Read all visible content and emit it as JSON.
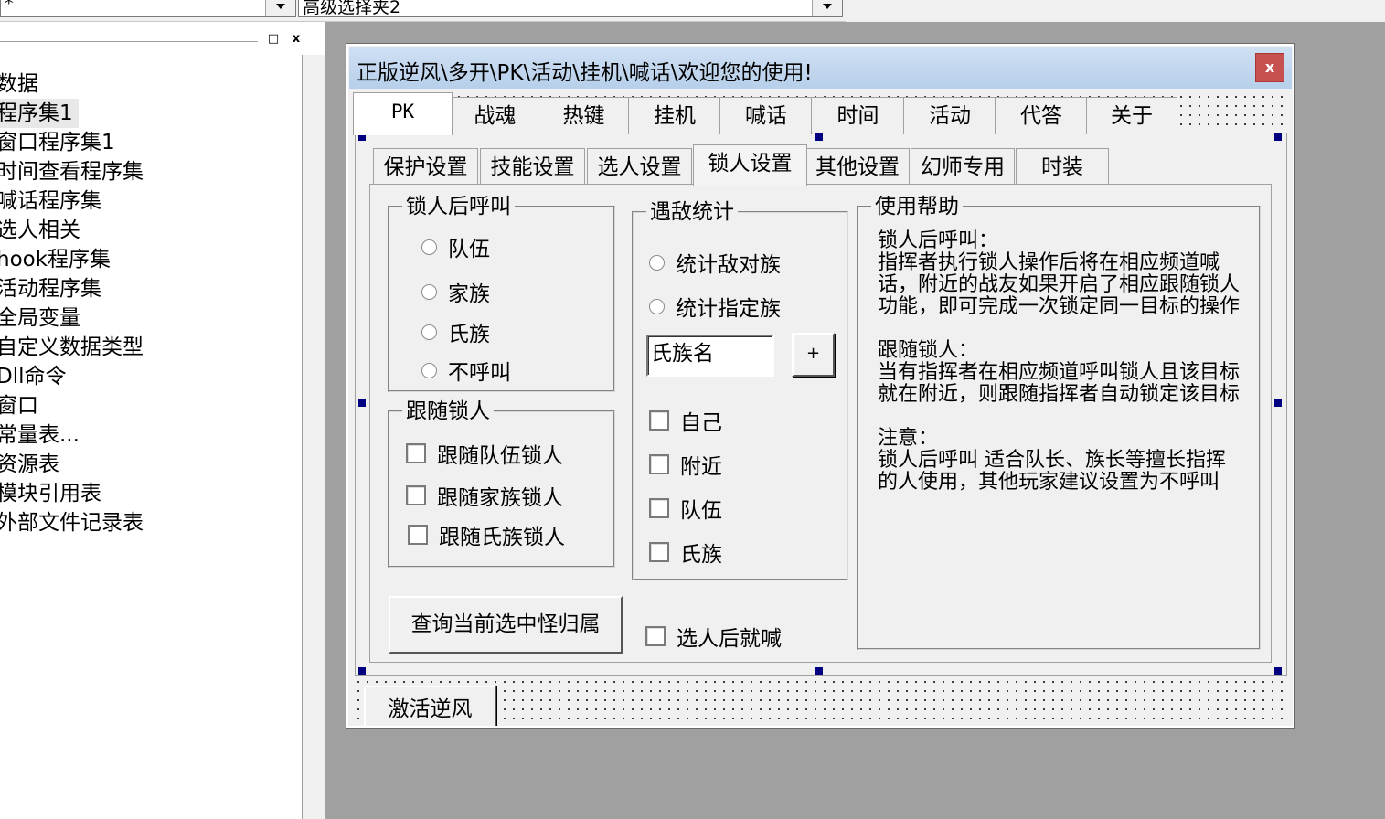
{
  "toolbar": {
    "combo1_value": "*",
    "combo2_value": "高级选择夹2"
  },
  "left_panel": {
    "tree_items": [
      "数据",
      "程序集1",
      "窗口程序集1",
      "时间查看程序集",
      "喊话程序集",
      "选人相关",
      "hook程序集",
      "活动程序集",
      "全局变量",
      "自定义数据类型",
      "Dll命令",
      "窗口",
      "常量表...",
      "资源表",
      "模块引用表",
      "外部文件记录表"
    ],
    "restore_label": "□",
    "close_label": "x"
  },
  "form": {
    "title": "正版逆风\\多开\\PK\\活动\\挂机\\喊话\\欢迎您的使用!",
    "close_label": "x",
    "outer_tabs": [
      "PK",
      "战魂",
      "热键",
      "挂机",
      "喊话",
      "时间",
      "活动",
      "代答",
      "关于"
    ],
    "inner_tabs": [
      "保护设置",
      "技能设置",
      "选人设置",
      "锁人设置",
      "其他设置",
      "幻师专用",
      "时装"
    ],
    "group_call": {
      "legend": "锁人后呼叫",
      "options": [
        "队伍",
        "家族",
        "氏族",
        "不呼叫"
      ]
    },
    "group_follow": {
      "legend": "跟随锁人",
      "options": [
        "跟随队伍锁人",
        "跟随家族锁人",
        "跟随氏族锁人"
      ]
    },
    "group_enemy": {
      "legend": "遇敌统计",
      "radios": [
        "统计敌对族",
        "统计指定族"
      ],
      "clan_input_value": "氏族名",
      "add_button": "+",
      "checks": [
        "自己",
        "附近",
        "队伍",
        "氏族"
      ]
    },
    "group_help": {
      "legend": "使用帮助",
      "text": "锁人后呼叫：\n指挥者执行锁人操作后将在相应频道喊话，附近的战友如果开启了相应跟随锁人功能，即可完成一次锁定同一目标的操作\n\n跟随锁人：\n当有指挥者在相应频道呼叫锁人且该目标就在附近，则跟随指挥者自动锁定该目标\n\n注意：\n锁人后呼叫 适合队长、族长等擅长指挥的人使用，其他玩家建议设置为不呼叫"
    },
    "query_button": "查询当前选中怪归属",
    "shout_after_select": "选人后就喊",
    "activate_button": "激活逆风"
  }
}
